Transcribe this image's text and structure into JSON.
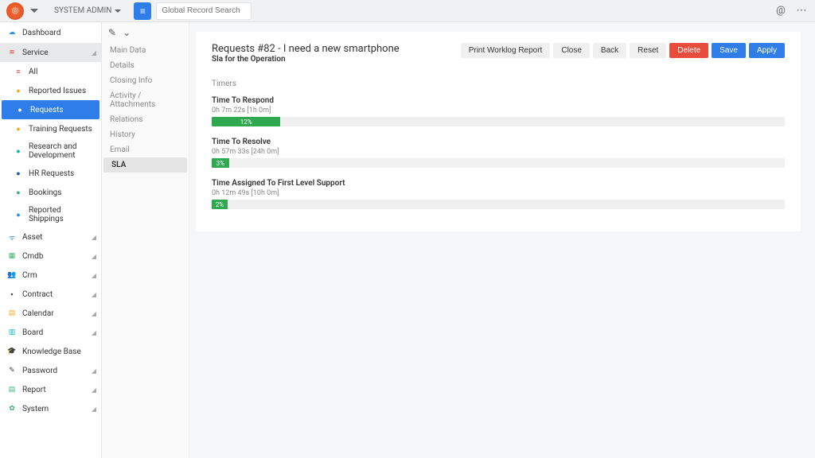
{
  "topbar": {
    "admin_label": "SYSTEM ADMIN",
    "search_placeholder": "Global Record Search"
  },
  "sidebar": {
    "dashboard": "Dashboard",
    "service": "Service",
    "service_items": [
      {
        "label": "All"
      },
      {
        "label": "Reported Issues"
      },
      {
        "label": "Requests"
      },
      {
        "label": "Training Requests"
      },
      {
        "label": "Research and Development"
      },
      {
        "label": "HR Requests"
      },
      {
        "label": "Bookings"
      },
      {
        "label": "Reported Shippings"
      }
    ],
    "items": [
      {
        "label": "Asset"
      },
      {
        "label": "Cmdb"
      },
      {
        "label": "Crm"
      },
      {
        "label": "Contract"
      },
      {
        "label": "Calendar"
      },
      {
        "label": "Board"
      },
      {
        "label": "Knowledge Base"
      },
      {
        "label": "Password"
      },
      {
        "label": "Report"
      },
      {
        "label": "System"
      }
    ]
  },
  "rec_tabs": {
    "items": [
      "Main Data",
      "Details",
      "Closing Info",
      "Activity / Attachments",
      "Relations",
      "History",
      "Email",
      "SLA"
    ],
    "active": "SLA"
  },
  "record": {
    "title": "Requests #82 - I need a new smartphone",
    "subtitle": "Sla for the Operation",
    "buttons": {
      "print": "Print Worklog Report",
      "close": "Close",
      "back": "Back",
      "reset": "Reset",
      "delete": "Delete",
      "save": "Save",
      "apply": "Apply"
    },
    "timers_head": "Timers",
    "timers": [
      {
        "title": "Time To Respond",
        "time": "0h 7m 22s [1h 0m]",
        "pct": 12,
        "pct_label": "12%"
      },
      {
        "title": "Time To Resolve",
        "time": "0h 57m 33s [24h 0m]",
        "pct": 3,
        "pct_label": "3%"
      },
      {
        "title": "Time Assigned To First Level Support",
        "time": "0h 12m 49s [10h 0m]",
        "pct": 2,
        "pct_label": "2%"
      }
    ]
  }
}
